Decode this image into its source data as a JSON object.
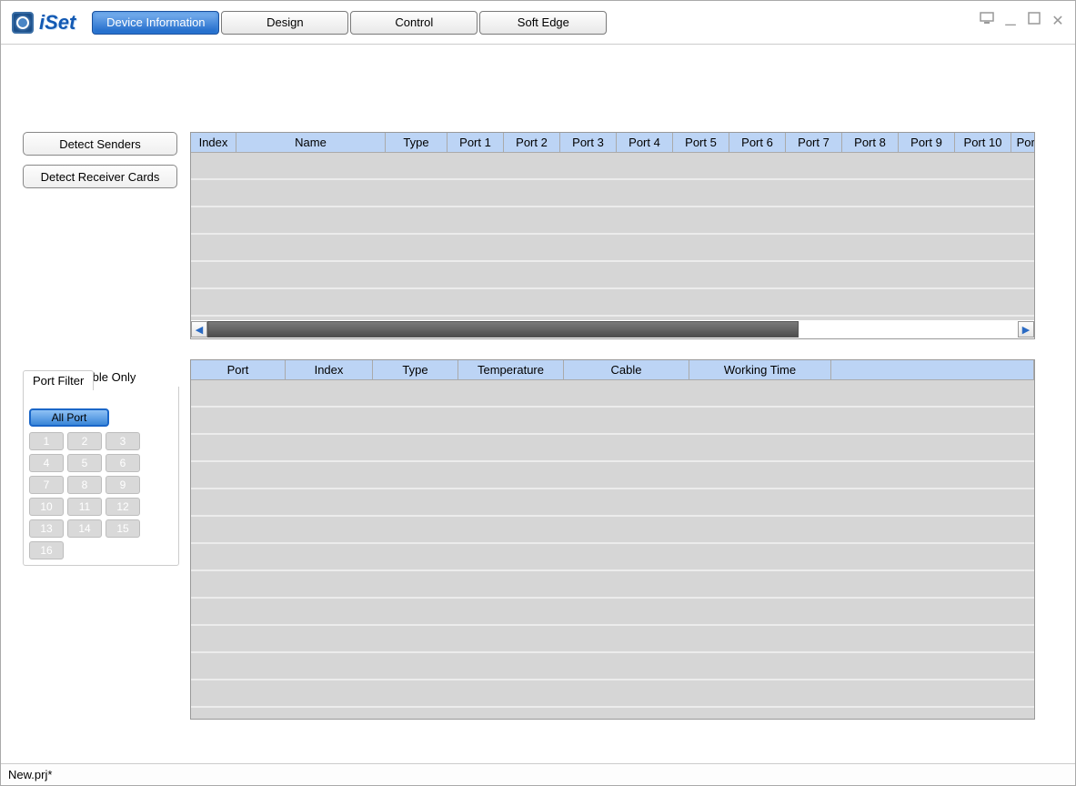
{
  "app": {
    "title": "iSet"
  },
  "tabs": {
    "device_info": "Device Information",
    "design": "Design",
    "control": "Control",
    "soft_edge": "Soft Edge",
    "active": "device_info"
  },
  "buttons": {
    "detect_senders": "Detect Senders",
    "detect_receivers": "Detect Receiver Cards"
  },
  "failed_cable": {
    "label": "Failed Cable Only",
    "checked": false
  },
  "port_filter": {
    "title": "Port Filter",
    "all_label": "All Port",
    "ports": [
      "1",
      "2",
      "3",
      "4",
      "5",
      "6",
      "7",
      "8",
      "9",
      "10",
      "11",
      "12",
      "13",
      "14",
      "15",
      "16"
    ]
  },
  "senders_table": {
    "headers": {
      "index": "Index",
      "name": "Name",
      "type": "Type",
      "port1": "Port 1",
      "port2": "Port 2",
      "port3": "Port 3",
      "port4": "Port 4",
      "port5": "Port 5",
      "port6": "Port 6",
      "port7": "Port 7",
      "port8": "Port 8",
      "port9": "Port 9",
      "port10": "Port 10",
      "port_more": "Port"
    },
    "rows": []
  },
  "receivers_table": {
    "headers": {
      "port": "Port",
      "index": "Index",
      "type": "Type",
      "temperature": "Temperature",
      "cable": "Cable",
      "working_time": "Working Time"
    },
    "rows": []
  },
  "status": {
    "filename": "New.prj*"
  }
}
